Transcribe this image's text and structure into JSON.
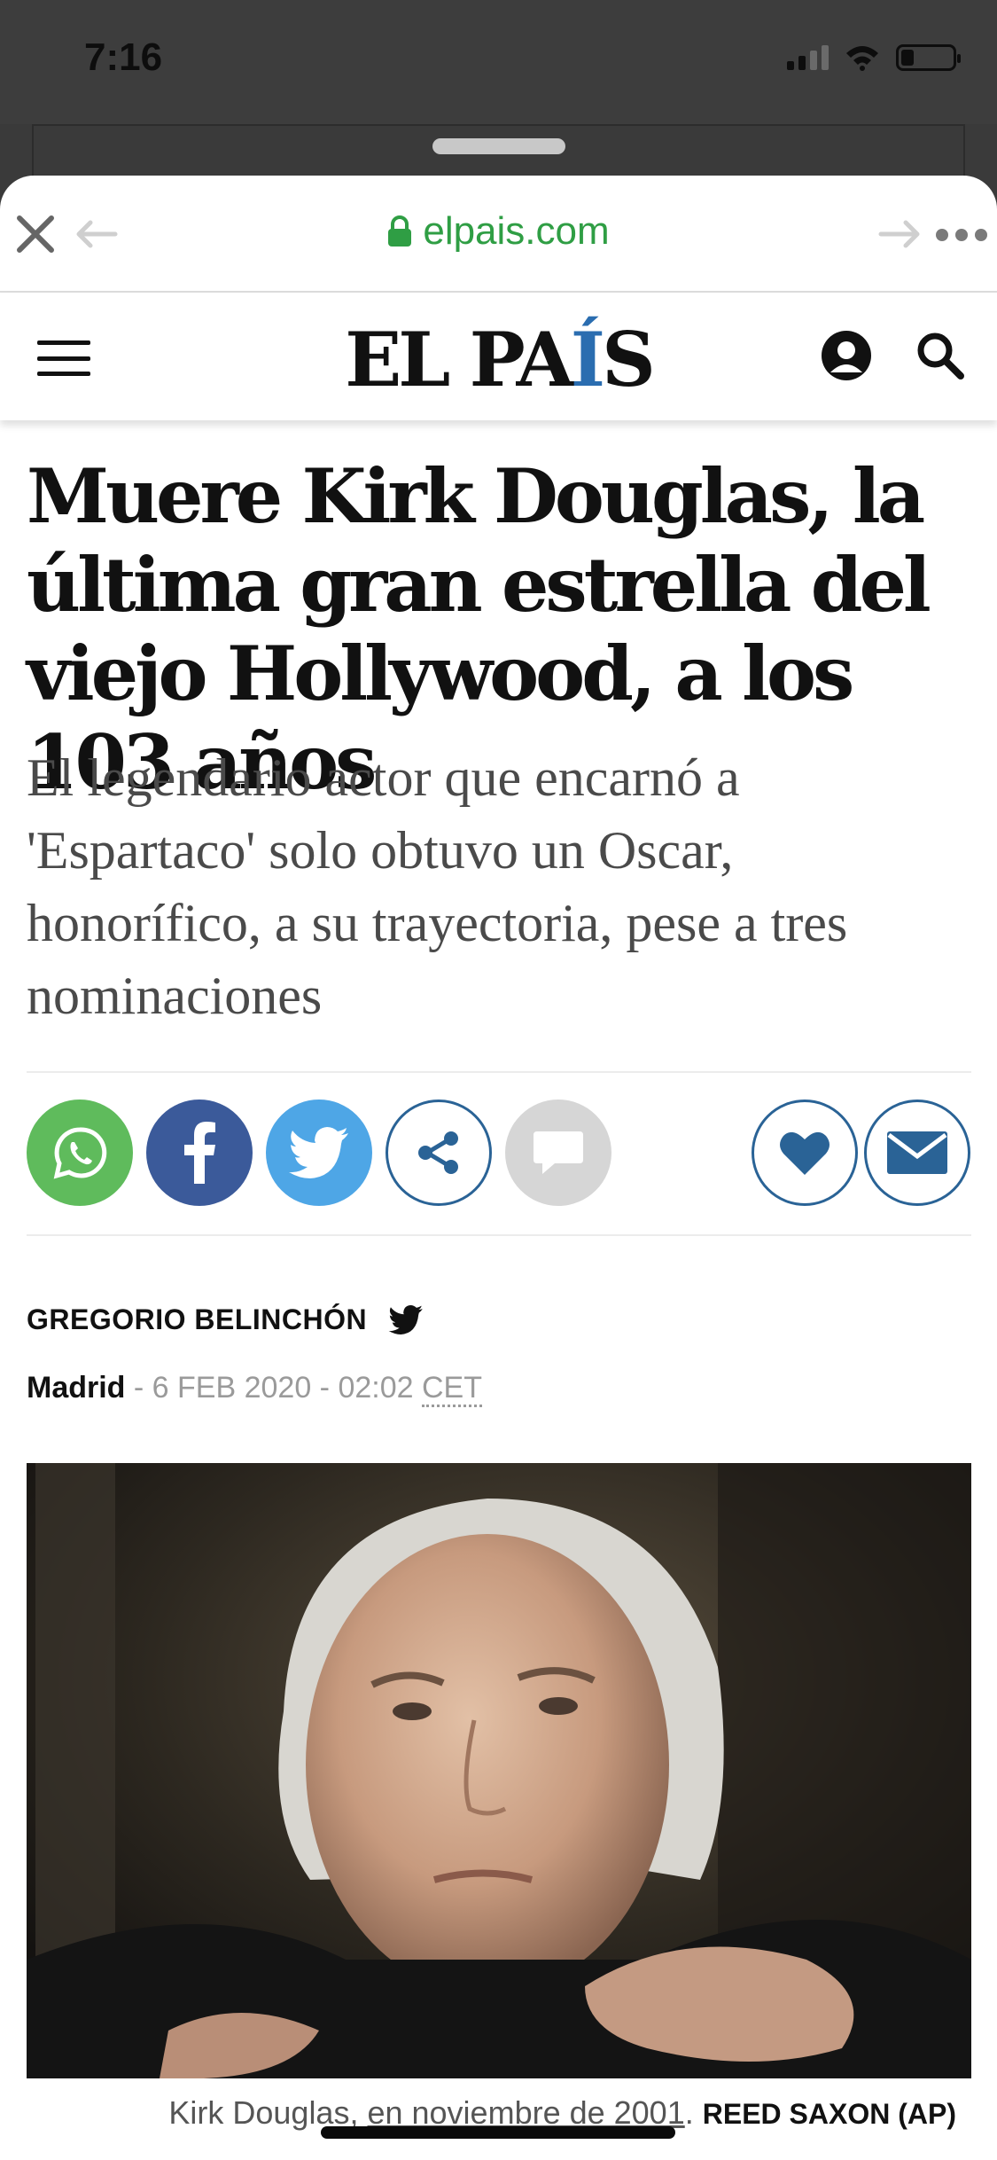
{
  "status_bar": {
    "time": "7:16"
  },
  "browser": {
    "url": "elpais.com"
  },
  "site": {
    "logo_main": "EL PA",
    "logo_accent": "Í",
    "logo_end": "S"
  },
  "article": {
    "headline": "Muere Kirk Douglas, la última gran estrella del viejo Hollywood, a los 103 años",
    "subheadline": "El legendario actor que encarnó a 'Espartaco' solo obtuvo un Oscar, honorífico, a su trayectoria, pese a tres nominaciones",
    "author": "GREGORIO BELINCHÓN",
    "city": "Madrid",
    "separator": " - ",
    "date": "6 FEB 2020 - 02:02",
    "timezone": "CET",
    "caption_text": "Kirk Douglas, ",
    "caption_link": "en noviembre de 2001",
    "caption_dot": ". ",
    "caption_credit": "REED SAXON (AP)"
  },
  "share_buttons": [
    {
      "name": "whatsapp",
      "color": "#5fbb5c"
    },
    {
      "name": "facebook",
      "color": "#3b5a9a"
    },
    {
      "name": "twitter",
      "color": "#4ea6e6"
    },
    {
      "name": "share",
      "color": "#2a6396"
    },
    {
      "name": "comments",
      "color": "#d6d6d6"
    },
    {
      "name": "favorite",
      "color": "#2a6396"
    },
    {
      "name": "email",
      "color": "#2a6396"
    }
  ]
}
